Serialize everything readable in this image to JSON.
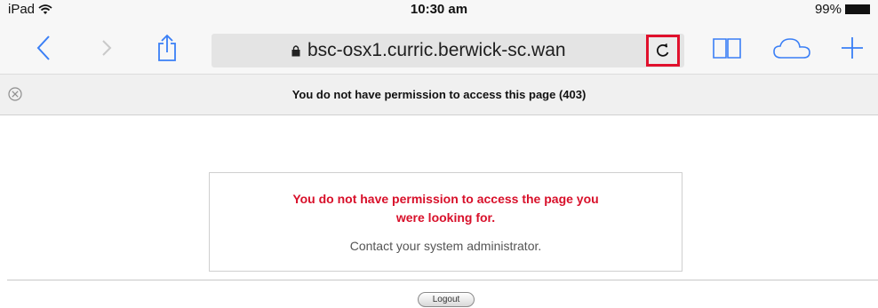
{
  "status_bar": {
    "device": "iPad",
    "time": "10:30 am",
    "battery": "99%"
  },
  "toolbar": {
    "url": "bsc-osx1.curric.berwick-sc.wan",
    "icons": {
      "back": "chevron-left-icon",
      "forward": "chevron-right-icon",
      "share": "share-icon",
      "lock": "lock-icon",
      "reload": "reload-icon",
      "bookmarks": "book-icon",
      "cloud": "cloud-icon",
      "add_tab": "plus-icon"
    },
    "accent_color": "#3a7ff6",
    "highlight_color": "#e0102c"
  },
  "tab": {
    "title": "You do not have permission to access this page (403)"
  },
  "page": {
    "error_heading_line1": "You do not have permission to access the page you",
    "error_heading_line2": "were looking for.",
    "error_subtext": "Contact your system administrator.",
    "logout_label": "Logout",
    "error_color": "#d8102a"
  }
}
